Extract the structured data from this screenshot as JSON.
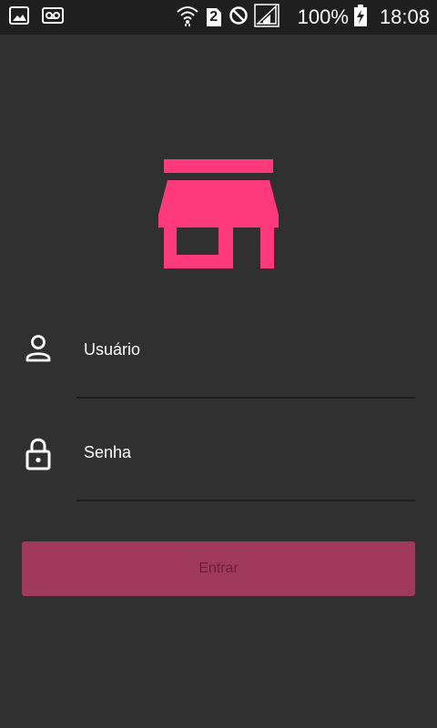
{
  "status_bar": {
    "battery": "100%",
    "time": "18:08",
    "sim_badge": "2",
    "icons": [
      "image-icon",
      "voicemail-icon",
      "wifi-icon",
      "sim-2-icon",
      "blocked-icon",
      "signal-icon",
      "battery-charging-icon"
    ]
  },
  "login": {
    "logo_icon": "store-icon",
    "username_placeholder": "Usuário",
    "password_placeholder": "Senha",
    "enter_label": "Entrar"
  },
  "colors": {
    "background": "#303030",
    "status_bar": "#1f1f1f",
    "accent": "#ff3a7c",
    "button_disabled": "#a0395b",
    "button_text": "#6b1f3a"
  }
}
